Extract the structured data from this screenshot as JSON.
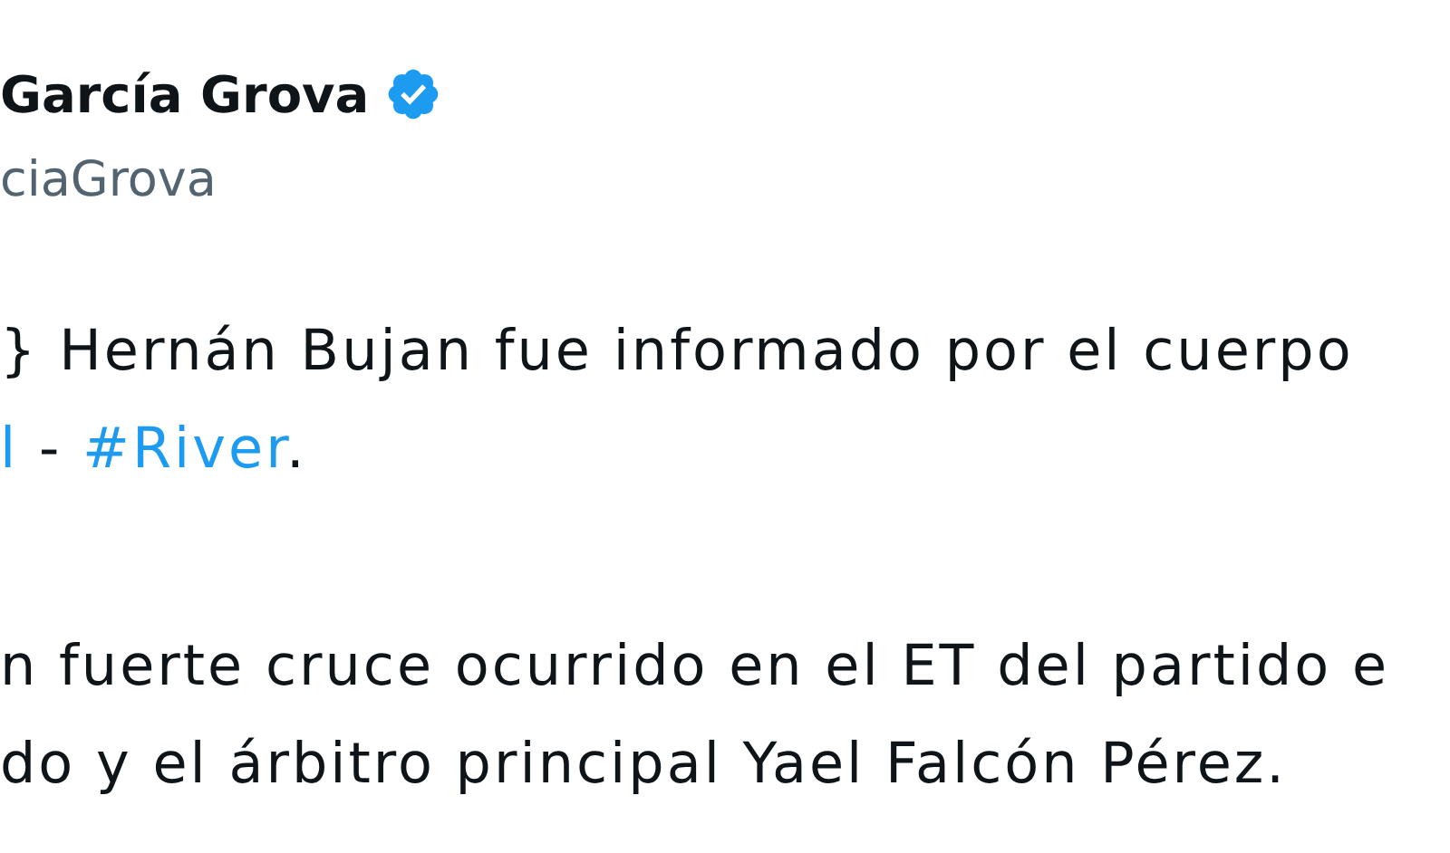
{
  "author": {
    "name": "García Grova",
    "verified": true,
    "handle": "ciaGrova"
  },
  "body": [
    {
      "kind": "text",
      "parts": [
        {
          "kind": "plain",
          "text": "} Hernán Bujan fue informado por el cuerpo"
        }
      ]
    },
    {
      "kind": "text",
      "parts": [
        {
          "kind": "link",
          "text": "l"
        },
        {
          "kind": "plain",
          "text": " - "
        },
        {
          "kind": "link",
          "text": "#River"
        },
        {
          "kind": "plain",
          "text": "."
        }
      ]
    },
    {
      "kind": "gap"
    },
    {
      "kind": "text",
      "parts": [
        {
          "kind": "plain",
          "text": "n fuerte cruce ocurrido en el ET del partido e"
        }
      ]
    },
    {
      "kind": "text",
      "parts": [
        {
          "kind": "plain",
          "text": "do y el árbitro principal Yael Falcón Pérez."
        }
      ]
    }
  ]
}
